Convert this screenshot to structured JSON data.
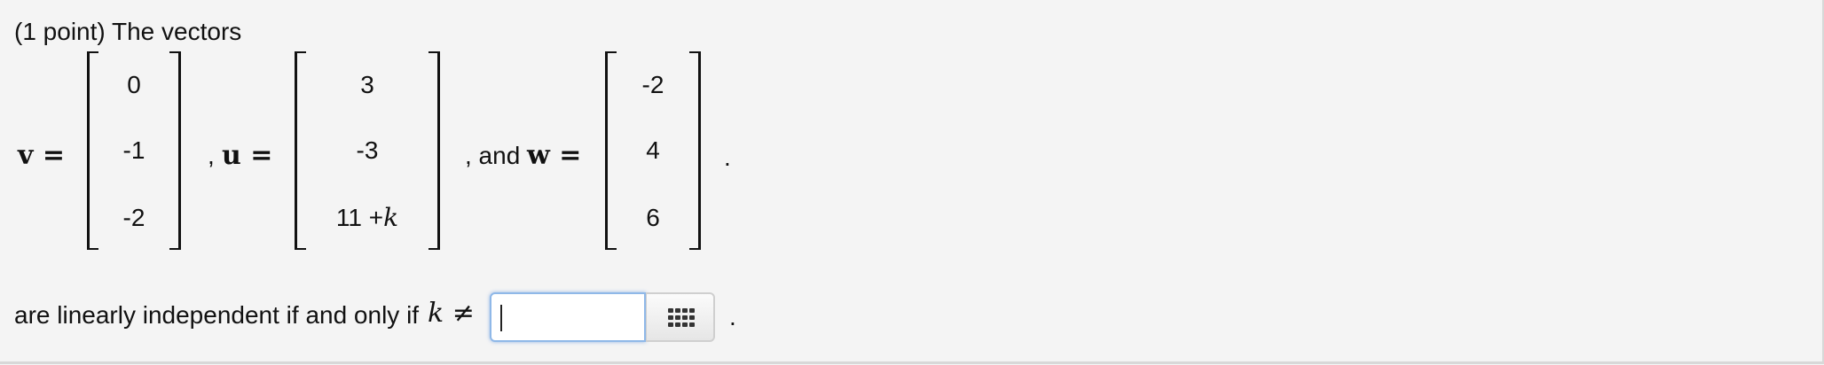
{
  "problem": {
    "intro": "(1 point) The vectors",
    "v_label": "v =",
    "u_label": "u =",
    "w_label": "w =",
    "sep_u": ",",
    "sep_w": ", and",
    "end_period": ".",
    "v": [
      "0",
      "-1",
      "-2"
    ],
    "u": [
      "3",
      "-3",
      "11 +",
      "k"
    ],
    "w": [
      "-2",
      "4",
      "6"
    ]
  },
  "answer": {
    "prompt": "are linearly independent if and only if",
    "variable": "k",
    "relation": "≠",
    "value": "",
    "end_period": ".",
    "matrix_button_icon": "matrix-grid-icon"
  }
}
